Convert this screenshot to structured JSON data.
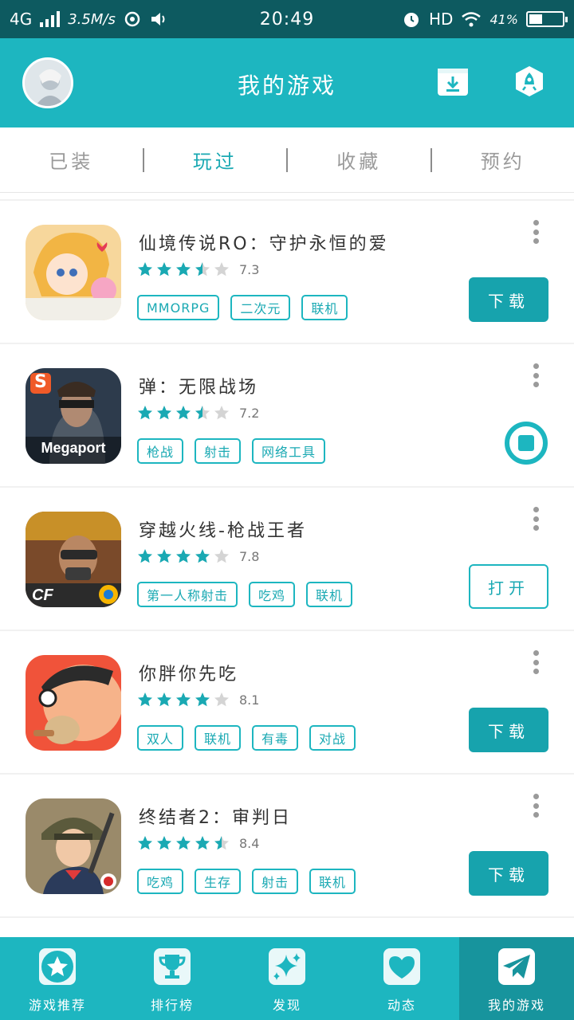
{
  "status_bar": {
    "network": "4G",
    "speed": "3.5M/s",
    "time": "20:49",
    "hd": "HD",
    "battery": "41%",
    "battery_level": 0.41
  },
  "header": {
    "title": "我的游戏",
    "download_manager_icon": "download-box-icon",
    "speedup_icon": "rocket-icon"
  },
  "tabs": [
    {
      "label": "已装",
      "active": false
    },
    {
      "label": "玩过",
      "active": true
    },
    {
      "label": "收藏",
      "active": false
    },
    {
      "label": "预约",
      "active": false
    }
  ],
  "games": [
    {
      "name": "仙境传说RO：守护永恒的爱",
      "rating": "7.3",
      "stars": 3.5,
      "tags": [
        "MMORPG",
        "二次元",
        "联机"
      ],
      "action": "download",
      "action_label": "下载"
    },
    {
      "name": "弹：无限战场",
      "rating": "7.2",
      "stars": 3.5,
      "tags": [
        "枪战",
        "射击",
        "网络工具"
      ],
      "action": "progress",
      "action_label": "",
      "icon_text": "Megaport",
      "icon_badge": "S"
    },
    {
      "name": "穿越火线-枪战王者",
      "rating": "7.8",
      "stars": 4,
      "tags": [
        "第一人称射击",
        "吃鸡",
        "联机"
      ],
      "action": "open",
      "action_label": "打开",
      "icon_text": "CF"
    },
    {
      "name": "你胖你先吃",
      "rating": "8.1",
      "stars": 4,
      "tags": [
        "双人",
        "联机",
        "有毒",
        "对战"
      ],
      "action": "download",
      "action_label": "下载"
    },
    {
      "name": "终结者2：审判日",
      "rating": "8.4",
      "stars": 4.5,
      "tags": [
        "吃鸡",
        "生存",
        "射击",
        "联机"
      ],
      "action": "download",
      "action_label": "下载"
    }
  ],
  "bottom_nav": [
    {
      "label": "游戏推荐",
      "icon": "star-icon",
      "active": false
    },
    {
      "label": "排行榜",
      "icon": "trophy-icon",
      "active": false
    },
    {
      "label": "发现",
      "icon": "sparkle-icon",
      "active": false
    },
    {
      "label": "动态",
      "icon": "heart-icon",
      "active": false
    },
    {
      "label": "我的游戏",
      "icon": "paper-plane-icon",
      "active": true
    }
  ],
  "colors": {
    "accent": "#1db6c0",
    "accent_dark": "#17a3ad",
    "status_bar": "#0d5a60",
    "star_on": "#1aa9b3",
    "star_off": "#d4d4d4"
  }
}
